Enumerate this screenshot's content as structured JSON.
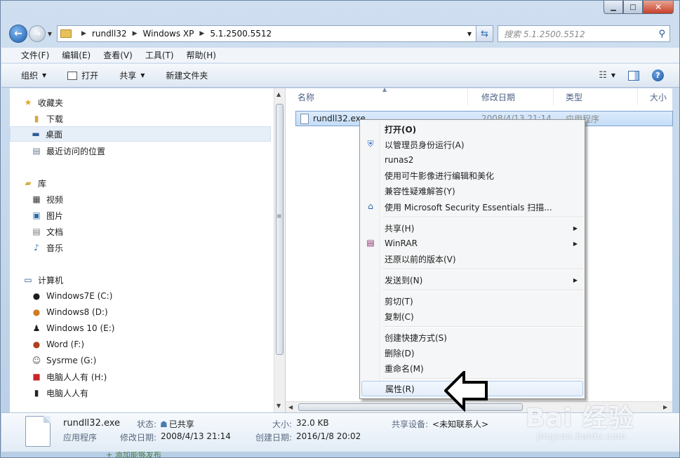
{
  "window": {
    "minimize_glyph": "▁",
    "maximize_glyph": "□",
    "close_glyph": "✕"
  },
  "address_bar": {
    "crumbs": [
      "rundll32",
      "Windows XP",
      "5.1.2500.5512"
    ],
    "search_placeholder": "搜索 5.1.2500.5512"
  },
  "menubar": [
    "文件(F)",
    "编辑(E)",
    "查看(V)",
    "工具(T)",
    "帮助(H)"
  ],
  "toolbar": {
    "organize": "组织",
    "open": "打开",
    "share": "共享",
    "new_folder": "新建文件夹"
  },
  "navigation": {
    "favorites": "收藏夹",
    "downloads": "下载",
    "desktop": "桌面",
    "recent": "最近访问的位置",
    "libraries": "库",
    "videos": "视频",
    "pictures": "图片",
    "documents": "文档",
    "music": "音乐",
    "computer": "计算机",
    "drives": [
      "Windows7E (C:)",
      "Windows8 (D:)",
      "Windows 10 (E:)",
      "Word (F:)",
      "Sysrme (G:)",
      "电脑人人有 (H:)",
      "电脑人人有"
    ]
  },
  "columns": {
    "name": "名称",
    "modified": "修改日期",
    "type": "类型",
    "size": "大小"
  },
  "file": {
    "name": "rundll32.exe",
    "modified": "2008/4/13 21:14",
    "type": "应用程序"
  },
  "context_menu": {
    "open": "打开(O)",
    "run_as_admin": "以管理员身份运行(A)",
    "runas2": "runas2",
    "edit_image": "使用可牛影像进行编辑和美化",
    "compat": "兼容性疑难解答(Y)",
    "mse_scan": "使用 Microsoft Security Essentials 扫描...",
    "share": "共享(H)",
    "winrar": "WinRAR",
    "restore": "还原以前的版本(V)",
    "send_to": "发送到(N)",
    "cut": "剪切(T)",
    "copy": "复制(C)",
    "shortcut": "创建快捷方式(S)",
    "delete": "删除(D)",
    "rename": "重命名(M)",
    "properties": "属性(R)"
  },
  "details": {
    "file_name": "rundll32.exe",
    "file_type": "应用程序",
    "status_label": "状态:",
    "status_value": "已共享",
    "modified_label": "修改日期:",
    "modified_value": "2008/4/13 21:14",
    "size_label": "大小:",
    "size_value": "32.0 KB",
    "created_label": "创建日期:",
    "created_value": "2016/1/8 20:02",
    "share_label": "共享设备:",
    "share_value": "<未知联系人>"
  },
  "watermark": {
    "main": "Bai 经验",
    "sub": "jingyan.baidu.com"
  },
  "bottom_strip": "+ 添加能够发布"
}
